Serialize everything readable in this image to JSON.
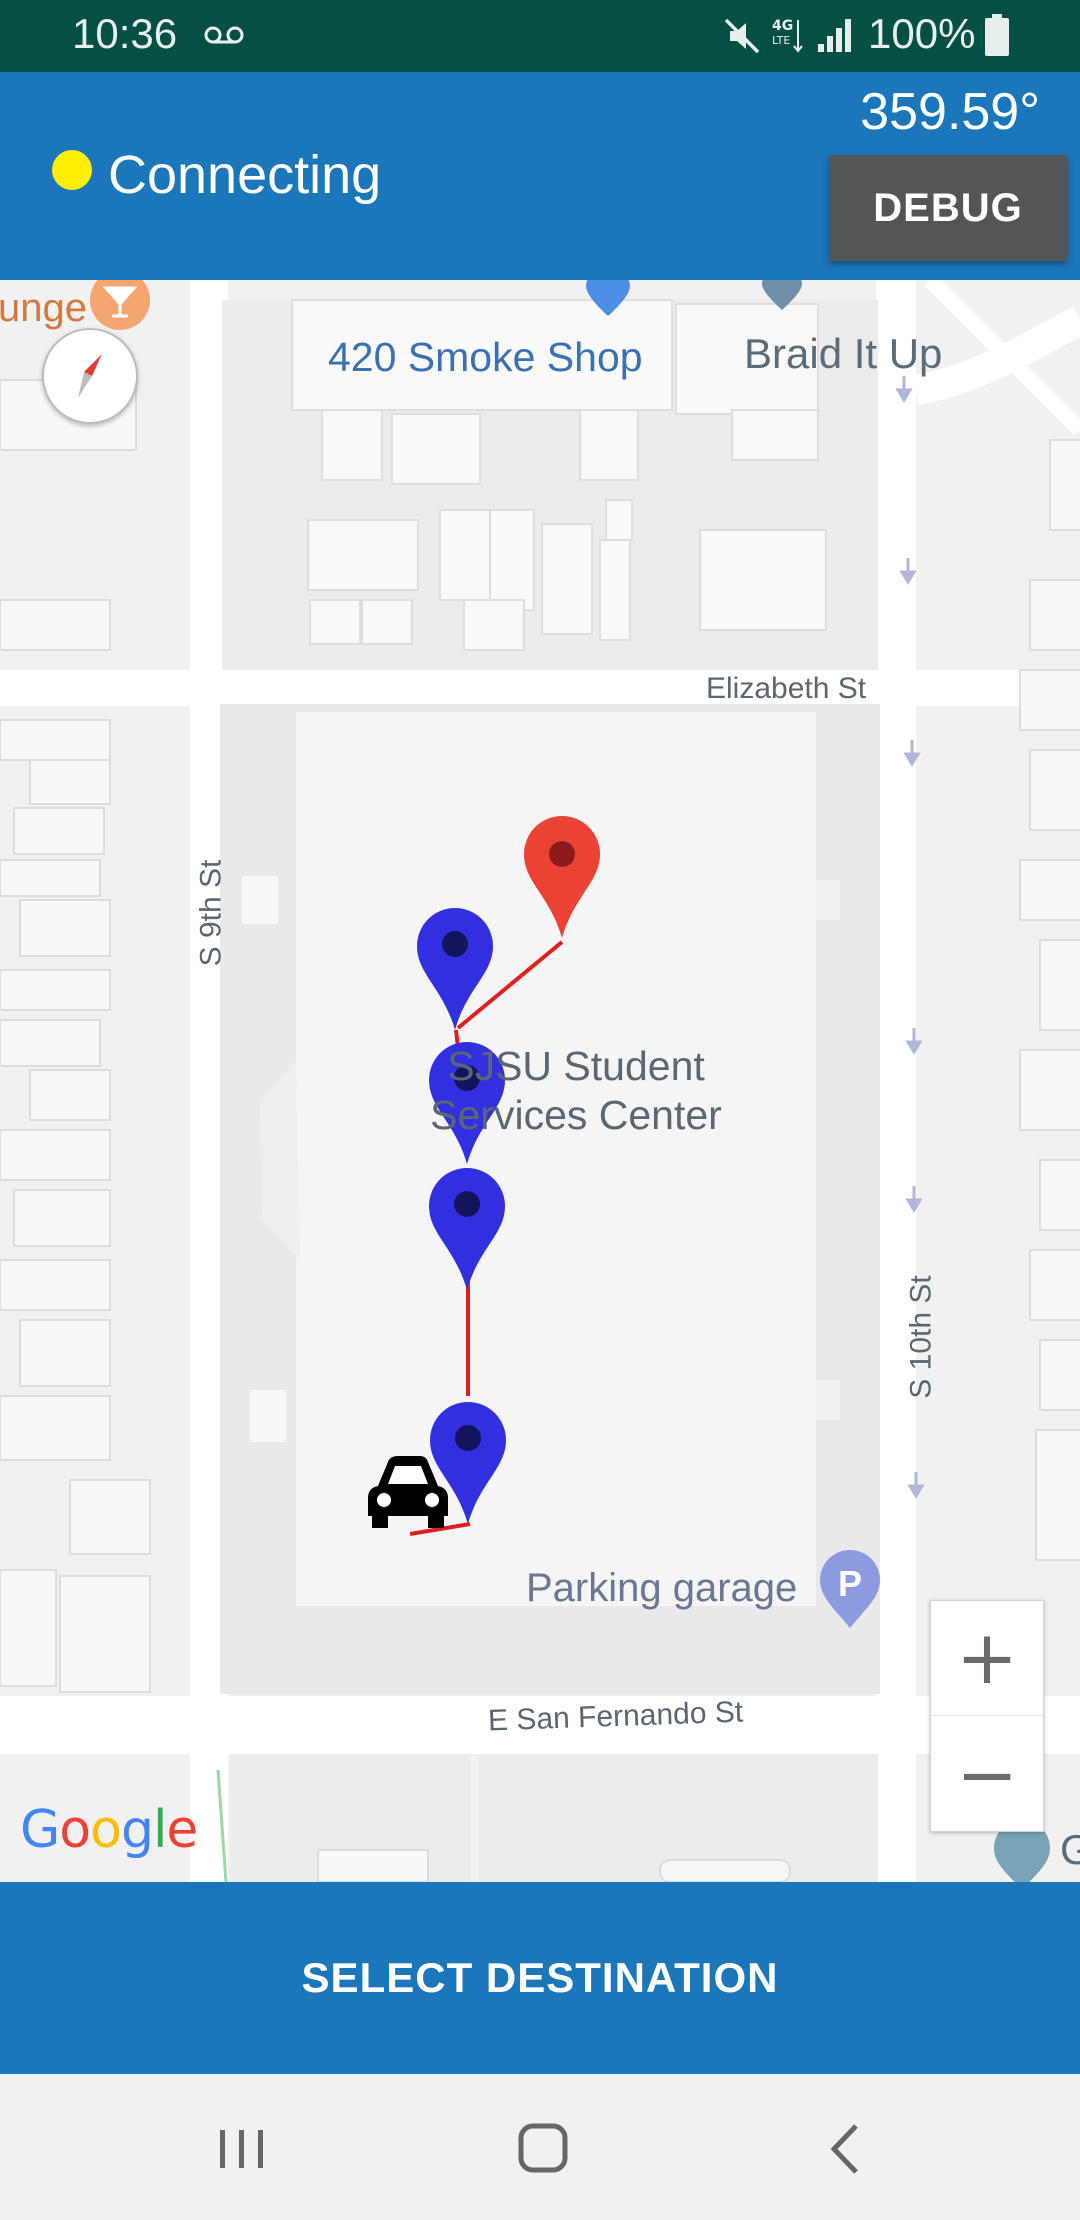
{
  "status_bar": {
    "time": "10:36",
    "battery": "100%",
    "background": "#055042"
  },
  "header": {
    "connection_status": "Connecting",
    "status_color": "#ffef00",
    "heading": "359.59°",
    "debug_label": "DEBUG",
    "background": "#1c76ba"
  },
  "map": {
    "labels": {
      "poi_left": "unge",
      "poi_smoke_shop": "420 Smoke Shop",
      "poi_braid": "Braid It Up",
      "street_elizabeth": "Elizabeth St",
      "street_9th": "S 9th St",
      "street_10th": "S 10th St",
      "building_line1": "SJSU Student",
      "building_line2": "Services Center",
      "parking": "Parking garage",
      "street_san_fernando": "E San Fernando St",
      "poi_right_partial": "G"
    },
    "google_logo": "Google",
    "route_color": "#e02020",
    "destination_marker_color": "#ea4335",
    "waypoint_marker_color": "#3030e0",
    "waypoints": 4,
    "zoom_in": "+",
    "zoom_out": "−"
  },
  "bottom": {
    "select_destination_label": "SELECT DESTINATION"
  },
  "icons": {
    "compass": "compass-icon",
    "car": "car-icon",
    "parking": "parking-icon",
    "recents": "recents-icon",
    "home": "home-icon",
    "back": "back-icon"
  }
}
